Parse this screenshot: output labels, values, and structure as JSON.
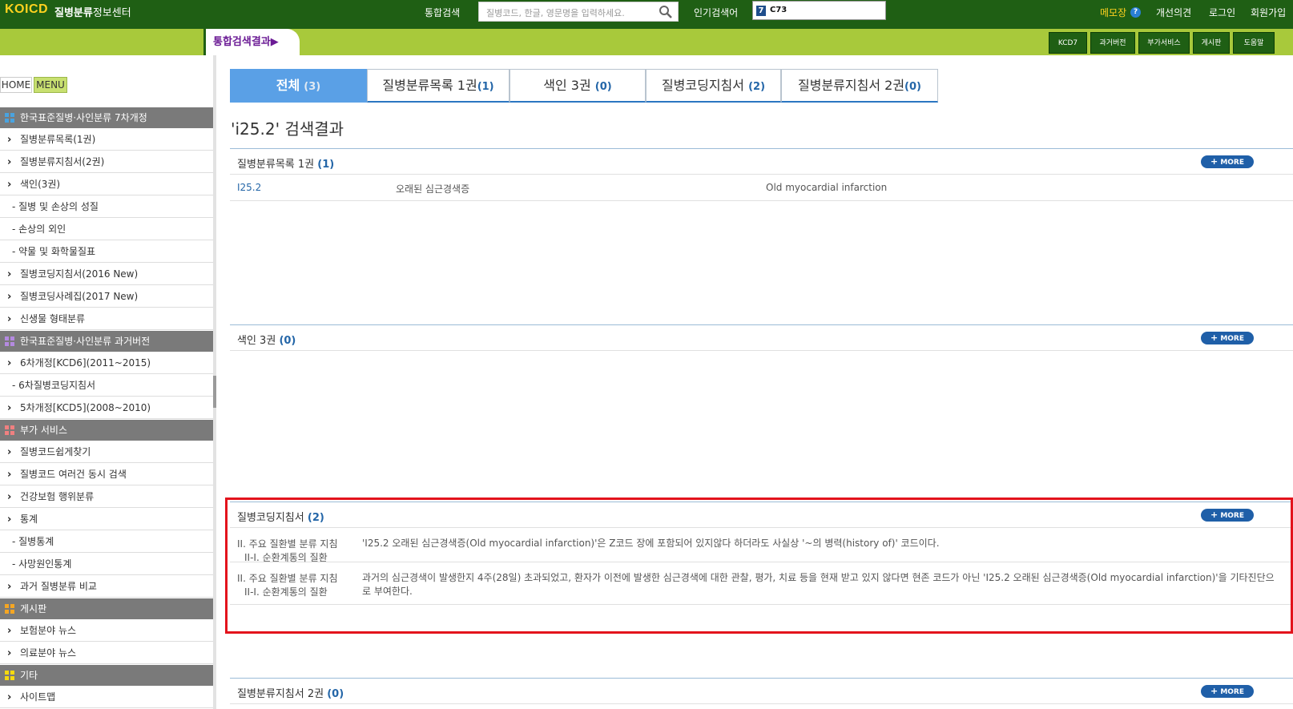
{
  "header": {
    "logo": "KOICD",
    "logo_bold": "질병분류",
    "logo_rest": "정보센터",
    "search_label": "통합검색",
    "search_placeholder": "질병코드, 한글, 영문명을 입력하세요.",
    "popular_label": "인기검색어",
    "popular_rank": "7",
    "popular_value": "C73",
    "memo": "메모장",
    "help": "?",
    "links": [
      "개선의견",
      "로그인",
      "회원가입"
    ]
  },
  "subbar": {
    "active_tab": "통합검색결과▶",
    "buttons": [
      "KCD7",
      "과거버전",
      "부가서비스",
      "게시판",
      "도움말"
    ]
  },
  "sidebar": {
    "home": "HOME",
    "menu": "MENU",
    "sections": [
      {
        "title": "한국표준질병·사인분류 7차개정",
        "color": "#4aa3df",
        "items": [
          {
            "label": "질병분류목록(1권)",
            "sub": false
          },
          {
            "label": "질병분류지침서(2권)",
            "sub": false
          },
          {
            "label": "색인(3권)",
            "sub": false
          },
          {
            "label": "- 질병 및 손상의 성질",
            "sub": true
          },
          {
            "label": "- 손상의 외인",
            "sub": true
          },
          {
            "label": "- 약물 및 화학물질표",
            "sub": true
          },
          {
            "label": "질병코딩지침서(2016 New)",
            "sub": false
          },
          {
            "label": "질병코딩사례집(2017 New)",
            "sub": false
          },
          {
            "label": "신생물 형태분류",
            "sub": false
          }
        ]
      },
      {
        "title": "한국표준질병·사인분류 과거버전",
        "color": "#b48ae0",
        "items": [
          {
            "label": "6차개정[KCD6](2011~2015)",
            "sub": false
          },
          {
            "label": "- 6차질병코딩지침서",
            "sub": true
          },
          {
            "label": "5차개정[KCD5](2008~2010)",
            "sub": false
          }
        ]
      },
      {
        "title": "부가 서비스",
        "color": "#f08080",
        "items": [
          {
            "label": "질병코드쉽게찾기",
            "sub": false
          },
          {
            "label": "질병코드 여러건 동시 검색",
            "sub": false
          },
          {
            "label": "건강보험 행위분류",
            "sub": false
          },
          {
            "label": "통계",
            "sub": false
          },
          {
            "label": "- 질병통계",
            "sub": true
          },
          {
            "label": "- 사망원인통계",
            "sub": true
          },
          {
            "label": "과거 질병분류 비교",
            "sub": false
          }
        ]
      },
      {
        "title": "게시판",
        "color": "#f5a623",
        "items": [
          {
            "label": "보험분야 뉴스",
            "sub": false
          },
          {
            "label": "의료분야 뉴스",
            "sub": false
          }
        ]
      },
      {
        "title": "기타",
        "color": "#f5d90f",
        "items": [
          {
            "label": "사이트맵",
            "sub": false
          }
        ]
      }
    ]
  },
  "tabs": [
    {
      "label": "전체",
      "count": "(3)"
    },
    {
      "label": "질병분류목록 1권",
      "count": "(1)"
    },
    {
      "label": "색인 3권",
      "count": "(0)"
    },
    {
      "label": "질병코딩지침서",
      "count": "(2)"
    },
    {
      "label": "질병분류지침서 2권",
      "count": "(0)"
    }
  ],
  "result_title": "'i25.2' 검색결과",
  "more_label": "MORE",
  "sections": {
    "list1": {
      "title": "질병분류목록 1권",
      "count": "(1)",
      "rows": [
        {
          "code": "I25.2",
          "kor": "오래된 심근경색증",
          "eng": "Old myocardial infarction"
        }
      ]
    },
    "index3": {
      "title": "색인 3권",
      "count": "(0)"
    },
    "coding": {
      "title": "질병코딩지침서",
      "count": "(2)",
      "rows": [
        {
          "cat1": "II. 주요 질환별 분류 지침",
          "cat2": "II-I. 순환계통의 질환",
          "desc": "'I25.2 오래된 심근경색증(Old myocardial infarction)'은 Z코드 장에 포함되어 있지않다 하더라도 사실상 '~의 병력(history of)' 코드이다."
        },
        {
          "cat1": "II. 주요 질환별 분류 지침",
          "cat2": "II-I. 순환계통의 질환",
          "desc": "과거의 심근경색이 발생한지 4주(28일) 초과되었고, 환자가 이전에 발생한 심근경색에 대한 관찰, 평가, 치료 등을 현재 받고 있지 않다면 현존 코드가 아닌 'I25.2 오래된 심근경색증(Old myocardial infarction)'을 기타진단으로 부여한다."
        }
      ]
    },
    "guide2": {
      "title": "질병분류지침서 2권",
      "count": "(0)"
    }
  }
}
